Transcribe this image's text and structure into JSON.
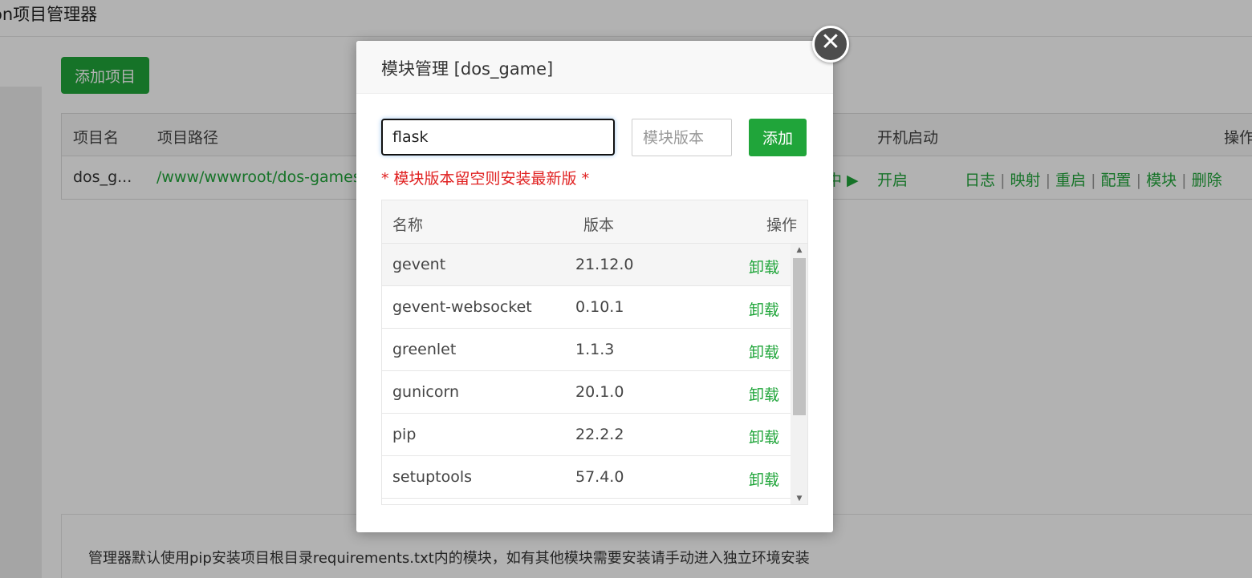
{
  "page": {
    "title": "on项目管理器",
    "add_project_label": "添加项目",
    "table": {
      "headers": {
        "name": "项目名",
        "path": "项目路径",
        "autostart": "开机启动",
        "actions": "操作"
      },
      "row": {
        "name": "dos_g...",
        "path": "/www/wwwroot/dos-games",
        "status_glyph": "中 ▶",
        "autostart": "开启",
        "actions": [
          "日志",
          "映射",
          "重启",
          "配置",
          "模块",
          "删除"
        ]
      }
    },
    "info_text": "管理器默认使用pip安装项目根目录requirements.txt内的模块，如有其他模块需要安装请手动进入独立环境安装"
  },
  "modal": {
    "title": "模块管理 [dos_game]",
    "close_glyph": "✕",
    "module_input_value": "flask",
    "version_placeholder": "模块版本",
    "add_label": "添加",
    "hint": "* 模块版本留空则安装最新版 *",
    "table": {
      "headers": {
        "name": "名称",
        "version": "版本",
        "action": "操作"
      },
      "rows": [
        {
          "name": "gevent",
          "version": "21.12.0",
          "action": "卸载"
        },
        {
          "name": "gevent-websocket",
          "version": "0.10.1",
          "action": "卸载"
        },
        {
          "name": "greenlet",
          "version": "1.1.3",
          "action": "卸载"
        },
        {
          "name": "gunicorn",
          "version": "20.1.0",
          "action": "卸载"
        },
        {
          "name": "pip",
          "version": "22.2.2",
          "action": "卸载"
        },
        {
          "name": "setuptools",
          "version": "57.4.0",
          "action": "卸载"
        }
      ]
    },
    "scroll_up_glyph": "▲",
    "scroll_down_glyph": "▼"
  }
}
